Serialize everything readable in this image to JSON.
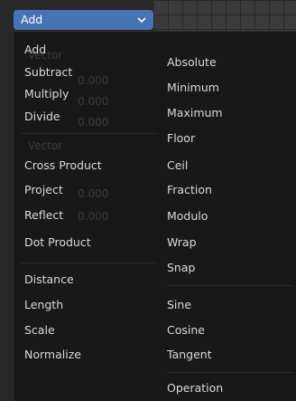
{
  "dropdown": {
    "value": "Add"
  },
  "left_items": [
    "Add",
    "Subtract",
    "Multiply",
    "Divide",
    "Cross Product",
    "Project",
    "Reflect",
    "Dot Product",
    "Distance",
    "Length",
    "Scale",
    "Normalize"
  ],
  "right_items": [
    "Absolute",
    "Minimum",
    "Maximum",
    "Floor",
    "Ceil",
    "Fraction",
    "Modulo",
    "Wrap",
    "Snap",
    "Sine",
    "Cosine",
    "Tangent"
  ],
  "right_header": "Operation",
  "ghost_text": {
    "vector_top": "Vector",
    "vector_mid": "Vector",
    "value": "0.000"
  },
  "colors": {
    "accent": "#4772b3",
    "menu_bg": "#181818",
    "text": "#d9d9d9"
  },
  "icons": {
    "chevron": "chevron-down-icon"
  }
}
